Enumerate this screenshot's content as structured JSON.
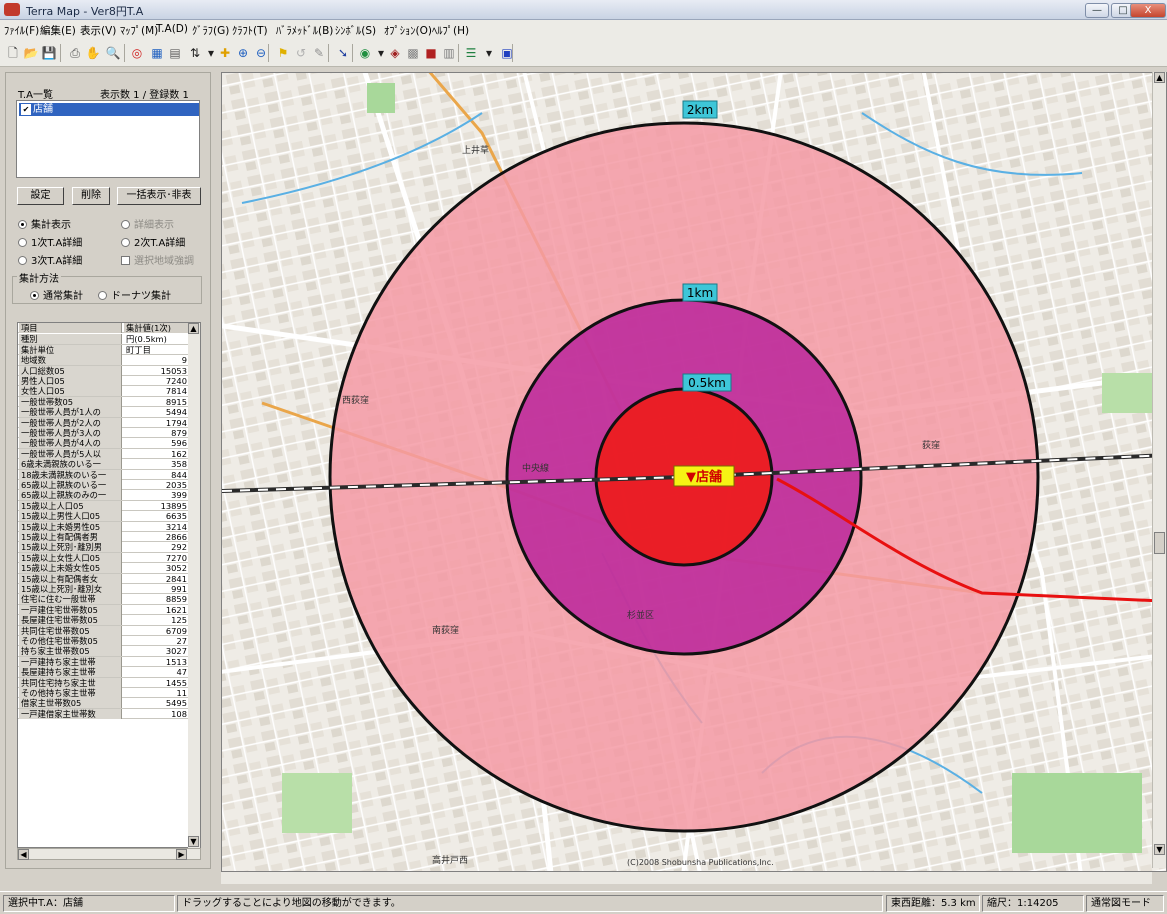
{
  "window": {
    "title": "Terra Map - Ver8円T.A",
    "controls": {
      "minimize": "—",
      "maximize": "□",
      "close": "X"
    }
  },
  "menu": [
    "ﾌｧｲﾙ(F)",
    "編集(E)",
    "表示(V)",
    "ﾏｯﾌﾟ(M)",
    "T.A(D)",
    "ｸﾞﾗﾌ(G)",
    "ｸﾗﾌﾄ(T)",
    "ﾊﾞﾗﾒｯﾄﾞﾙ(B)",
    "ｼﾝﾎﾞﾙ(S)",
    "ｵﾌﾟｼｮﾝ(O)",
    "ﾍﾙﾌﾟ(H)"
  ],
  "toolbar": [
    {
      "icon": "new-file-icon",
      "glyph": "🗋",
      "color": "#333333"
    },
    {
      "icon": "open-folder-icon",
      "glyph": "📂",
      "color": "#c89a2e"
    },
    {
      "icon": "save-icon",
      "glyph": "💾",
      "color": "#2a3f8f"
    },
    {
      "icon": "print-icon",
      "glyph": "⎙",
      "color": "#555555"
    },
    {
      "icon": "hand-icon",
      "glyph": "✋",
      "color": "#666666"
    },
    {
      "icon": "zoom-icon",
      "glyph": "🔍",
      "color": "#555555"
    },
    {
      "icon": "target-icon",
      "glyph": "◎",
      "color": "#d02020"
    },
    {
      "icon": "table-icon",
      "glyph": "▦",
      "color": "#2060c0"
    },
    {
      "icon": "layer-icon",
      "glyph": "▤",
      "color": "#606060"
    },
    {
      "icon": "sort-icon",
      "glyph": "⇅",
      "color": "#202020"
    },
    {
      "icon": "dropdown-arrow-icon",
      "glyph": "▾",
      "color": "#202020"
    },
    {
      "icon": "plus-pin-icon",
      "glyph": "✚",
      "color": "#e0a000"
    },
    {
      "icon": "zoom-in-icon",
      "glyph": "⊕",
      "color": "#2060c0"
    },
    {
      "icon": "zoom-out-icon",
      "glyph": "⊖",
      "color": "#2060c0"
    },
    {
      "icon": "flag-icon",
      "glyph": "⚑",
      "color": "#e0b000"
    },
    {
      "icon": "lasso-icon",
      "glyph": "↺",
      "color": "#b0b0b0"
    },
    {
      "icon": "pen-icon",
      "glyph": "✎",
      "color": "#909090"
    },
    {
      "icon": "arrow-icon",
      "glyph": "➘",
      "color": "#2040a0"
    },
    {
      "icon": "eye-icon",
      "glyph": "◉",
      "color": "#209040"
    },
    {
      "icon": "dropdown-arrow-icon",
      "glyph": "▾",
      "color": "#202020"
    },
    {
      "icon": "globe-icon",
      "glyph": "◈",
      "color": "#a02020"
    },
    {
      "icon": "grid-icon",
      "glyph": "▩",
      "color": "#808080"
    },
    {
      "icon": "red-box-icon",
      "glyph": "■",
      "color": "#b02020"
    },
    {
      "icon": "graph-icon",
      "glyph": "▥",
      "color": "#808080"
    },
    {
      "icon": "list-icon",
      "glyph": "☰",
      "color": "#208040"
    },
    {
      "icon": "dropdown-arrow-icon",
      "glyph": "▾",
      "color": "#202020"
    },
    {
      "icon": "window-icon",
      "glyph": "▣",
      "color": "#2040c0"
    }
  ],
  "left_panel": {
    "ta_list_label": "T.A一覧",
    "count_label": "表示数 1 / 登録数 1",
    "ta_items": [
      "店舗"
    ],
    "buttons": {
      "settings": "設定",
      "delete": "削除",
      "toggle_all": "一括表示･非表"
    },
    "radios": {
      "total": "集計表示",
      "detail": "詳細表示",
      "primary": "1次T.A詳細",
      "secondary": "2次T.A詳細",
      "tertiary": "3次T.A詳細",
      "area_emph": "選択地域強調"
    },
    "method_label": "集計方法",
    "method": {
      "normal": "通常集計",
      "donut": "ドーナツ集計"
    },
    "table": {
      "header_key": "項目",
      "header_value": "集計値(1次)",
      "rows": [
        [
          "種別",
          "円(0.5km)"
        ],
        [
          "集計単位",
          "町丁目"
        ],
        [
          "地域数",
          "9"
        ],
        [
          "人口総数05",
          "15053"
        ],
        [
          "男性人口05",
          "7240"
        ],
        [
          "女性人口05",
          "7814"
        ],
        [
          "一般世帯数05",
          "8915"
        ],
        [
          "一般世帯人員が1人の",
          "5494"
        ],
        [
          "一般世帯人員が2人の",
          "1794"
        ],
        [
          "一般世帯人員が3人の",
          "879"
        ],
        [
          "一般世帯人員が4人の",
          "596"
        ],
        [
          "一般世帯人員が5人以",
          "162"
        ],
        [
          "6歳未満親族のいる一",
          "358"
        ],
        [
          "18歳未満親族のいる一",
          "844"
        ],
        [
          "65歳以上親族のいる一",
          "2035"
        ],
        [
          "65歳以上親族のみの一",
          "399"
        ],
        [
          "15歳以上人口05",
          "13895"
        ],
        [
          "15歳以上男性人口05",
          "6635"
        ],
        [
          "15歳以上未婚男性05",
          "3214"
        ],
        [
          "15歳以上有配偶者男",
          "2866"
        ],
        [
          "15歳以上死別･離別男",
          "292"
        ],
        [
          "15歳以上女性人口05",
          "7270"
        ],
        [
          "15歳以上未婚女性05",
          "3052"
        ],
        [
          "15歳以上有配偶者女",
          "2841"
        ],
        [
          "15歳以上死別･離別女",
          "991"
        ],
        [
          "住宅に住む一般世帯",
          "8859"
        ],
        [
          "一戸建住宅世帯数05",
          "1621"
        ],
        [
          "長屋建住宅世帯数05",
          "125"
        ],
        [
          "共同住宅世帯数05",
          "6709"
        ],
        [
          "その他住宅世帯数05",
          "27"
        ],
        [
          "持ち家主世帯数05",
          "3027"
        ],
        [
          "一戸建持ち家主世帯",
          "1513"
        ],
        [
          "長屋建持ち家主世帯",
          "47"
        ],
        [
          "共同住宅持ち家主世",
          "1455"
        ],
        [
          "その他持ち家主世帯",
          "11"
        ],
        [
          "借家主世帯数05",
          "5495"
        ],
        [
          "一戸建借家主世帯数",
          "108"
        ]
      ]
    }
  },
  "map": {
    "rings": [
      {
        "label": "2km",
        "fill": "#f0a0a8"
      },
      {
        "label": "1km",
        "fill": "#b8208c"
      },
      {
        "label": "0.5km",
        "fill": "#e81c1c"
      }
    ],
    "store_label": "▼店舗",
    "labels": [
      "杉並区",
      "高井戸西",
      "西荻窪",
      "上井草",
      "中央線",
      "南荻窪",
      "荻窪"
    ],
    "copyright": "(C)2008 Shobunsha Publications,Inc."
  },
  "status": {
    "selected": "選択中T.A：店舗",
    "hint": "ドラッグすることにより地図の移動ができます。",
    "distance": "東西距離：5.3 km",
    "scale": "縮尺：1:14205",
    "mode": "通常図モード"
  }
}
